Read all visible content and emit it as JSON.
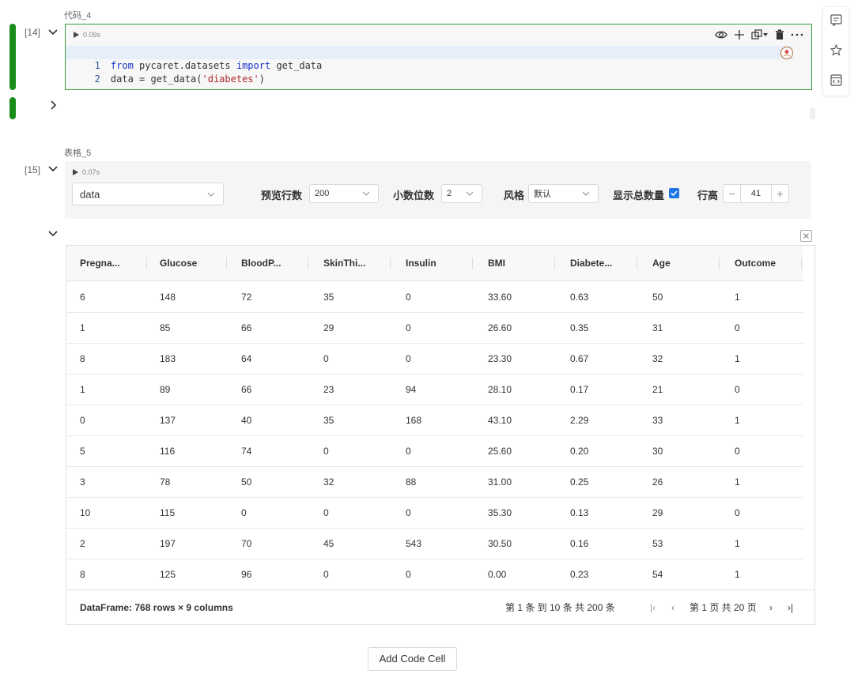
{
  "code_cell": {
    "label": "代码_4",
    "exec_count": "[14]",
    "run_time": "0.09s",
    "lines": [
      {
        "num": "1",
        "tokens": [
          {
            "t": "from",
            "c": "kw"
          },
          {
            "t": " pycaret.datasets ",
            "c": ""
          },
          {
            "t": "import",
            "c": "kw"
          },
          {
            "t": " get_data",
            "c": ""
          }
        ]
      },
      {
        "num": "2",
        "tokens": [
          {
            "t": "data = get_data(",
            "c": ""
          },
          {
            "t": "'diabetes'",
            "c": "str"
          },
          {
            "t": ")",
            "c": ""
          }
        ]
      }
    ]
  },
  "table_cell": {
    "label": "表格_5",
    "exec_count": "[15]",
    "run_time": "0.07s",
    "dataset_select": "data",
    "preview_rows_label": "预览行数",
    "preview_rows_value": "200",
    "decimals_label": "小数位数",
    "decimals_value": "2",
    "style_label": "风格",
    "style_value": "默认",
    "show_total_label": "显示总数量",
    "row_height_label": "行高",
    "row_height_value": "41",
    "row_height_minus": "−",
    "row_height_plus": "+"
  },
  "table": {
    "columns": [
      "Pregna...",
      "Glucose",
      "BloodP...",
      "SkinThi...",
      "Insulin",
      "BMI",
      "Diabete...",
      "Age",
      "Outcome"
    ],
    "rows": [
      [
        "6",
        "148",
        "72",
        "35",
        "0",
        "33.60",
        "0.63",
        "50",
        "1"
      ],
      [
        "1",
        "85",
        "66",
        "29",
        "0",
        "26.60",
        "0.35",
        "31",
        "0"
      ],
      [
        "8",
        "183",
        "64",
        "0",
        "0",
        "23.30",
        "0.67",
        "32",
        "1"
      ],
      [
        "1",
        "89",
        "66",
        "23",
        "94",
        "28.10",
        "0.17",
        "21",
        "0"
      ],
      [
        "0",
        "137",
        "40",
        "35",
        "168",
        "43.10",
        "2.29",
        "33",
        "1"
      ],
      [
        "5",
        "116",
        "74",
        "0",
        "0",
        "25.60",
        "0.20",
        "30",
        "0"
      ],
      [
        "3",
        "78",
        "50",
        "32",
        "88",
        "31.00",
        "0.25",
        "26",
        "1"
      ],
      [
        "10",
        "115",
        "0",
        "0",
        "0",
        "35.30",
        "0.13",
        "29",
        "0"
      ],
      [
        "2",
        "197",
        "70",
        "45",
        "543",
        "30.50",
        "0.16",
        "53",
        "1"
      ],
      [
        "8",
        "125",
        "96",
        "0",
        "0",
        "0.00",
        "0.23",
        "54",
        "1"
      ]
    ],
    "footer_info": "DataFrame: 768 rows × 9 columns",
    "range_text": "第 1 条 到 10 条 共 200 条",
    "page_text": "第 1 页 共 20 页",
    "pager": {
      "first": "|‹",
      "prev": "‹",
      "next": "›",
      "last": "›|"
    }
  },
  "add_code_cell": "Add Code Cell"
}
